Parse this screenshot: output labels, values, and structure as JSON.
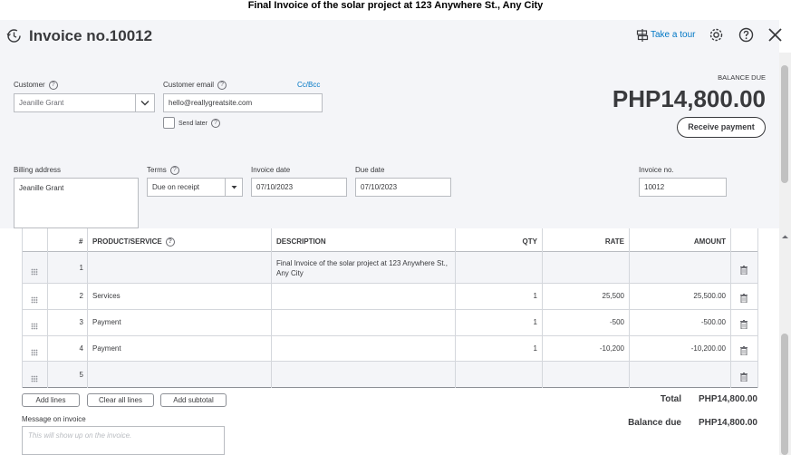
{
  "caption": "Final Invoice of the solar project at 123 Anywhere St., Any City",
  "header": {
    "title": "Invoice no.10012",
    "take_tour": "Take a tour",
    "balance_due_label": "BALANCE DUE",
    "balance_due_value": "PHP14,800.00",
    "receive_payment": "Receive payment"
  },
  "form": {
    "customer_label": "Customer",
    "customer_value": "Jeanille Grant",
    "email_label": "Customer email",
    "email_value": "hello@reallygreatsite.com",
    "ccbcc": "Cc/Bcc",
    "send_later": "Send later",
    "billing_label": "Billing address",
    "billing_value": "Jeanille Grant",
    "terms_label": "Terms",
    "terms_value": "Due on receipt",
    "invoice_date_label": "Invoice date",
    "invoice_date_value": "07/10/2023",
    "due_date_label": "Due date",
    "due_date_value": "07/10/2023",
    "invoice_no_label": "Invoice no.",
    "invoice_no_value": "10012"
  },
  "table": {
    "headers": {
      "num": "#",
      "product": "PRODUCT/SERVICE",
      "description": "DESCRIPTION",
      "qty": "QTY",
      "rate": "RATE",
      "amount": "AMOUNT"
    },
    "rows": [
      {
        "num": "1",
        "product": "",
        "description": "Final Invoice of the solar project at 123 Anywhere St., Any City",
        "qty": "",
        "rate": "",
        "amount": ""
      },
      {
        "num": "2",
        "product": "Services",
        "description": "",
        "qty": "1",
        "rate": "25,500",
        "amount": "25,500.00"
      },
      {
        "num": "3",
        "product": "Payment",
        "description": "",
        "qty": "1",
        "rate": "-500",
        "amount": "-500.00"
      },
      {
        "num": "4",
        "product": "Payment",
        "description": "",
        "qty": "1",
        "rate": "-10,200",
        "amount": "-10,200.00"
      },
      {
        "num": "5",
        "product": "",
        "description": "",
        "qty": "",
        "rate": "",
        "amount": ""
      }
    ]
  },
  "footer": {
    "add_lines": "Add lines",
    "clear_lines": "Clear all lines",
    "add_subtotal": "Add subtotal",
    "total_label": "Total",
    "total_value": "PHP14,800.00",
    "balance_label": "Balance due",
    "balance_value": "PHP14,800.00",
    "message_label": "Message on invoice",
    "message_placeholder": "This will show up on the invoice."
  },
  "colors": {
    "accent": "#0077c5",
    "header_bg": "#f4f5f8"
  }
}
